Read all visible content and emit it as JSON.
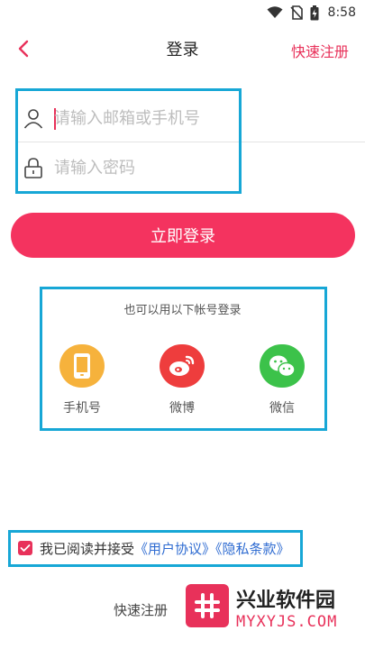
{
  "status_bar": {
    "time": "8:58"
  },
  "nav": {
    "title": "登录",
    "register_link": "快速注册"
  },
  "form": {
    "account": {
      "value": "",
      "placeholder": "请输入邮箱或手机号"
    },
    "password": {
      "value": "",
      "placeholder": "请输入密码"
    }
  },
  "login_button": "立即登录",
  "alt_login": {
    "title": "也可以用以下帐号登录",
    "options": [
      {
        "label": "手机号",
        "color": "#f6b23c"
      },
      {
        "label": "微博",
        "color": "#ee3d3d"
      },
      {
        "label": "微信",
        "color": "#3cc24a"
      }
    ]
  },
  "agreement": {
    "checked": true,
    "text": "我已阅读并接受",
    "user_agreement": "《用户协议》",
    "privacy_policy": "《隐私条款》"
  },
  "bottom": {
    "register": "快速注册"
  },
  "watermark": {
    "title": "兴业软件园",
    "url": "MYXYJS.COM"
  },
  "colors": {
    "accent": "#e8315a",
    "button": "#f4335f",
    "highlight": "#17a7d6",
    "link": "#2e6bd1"
  }
}
